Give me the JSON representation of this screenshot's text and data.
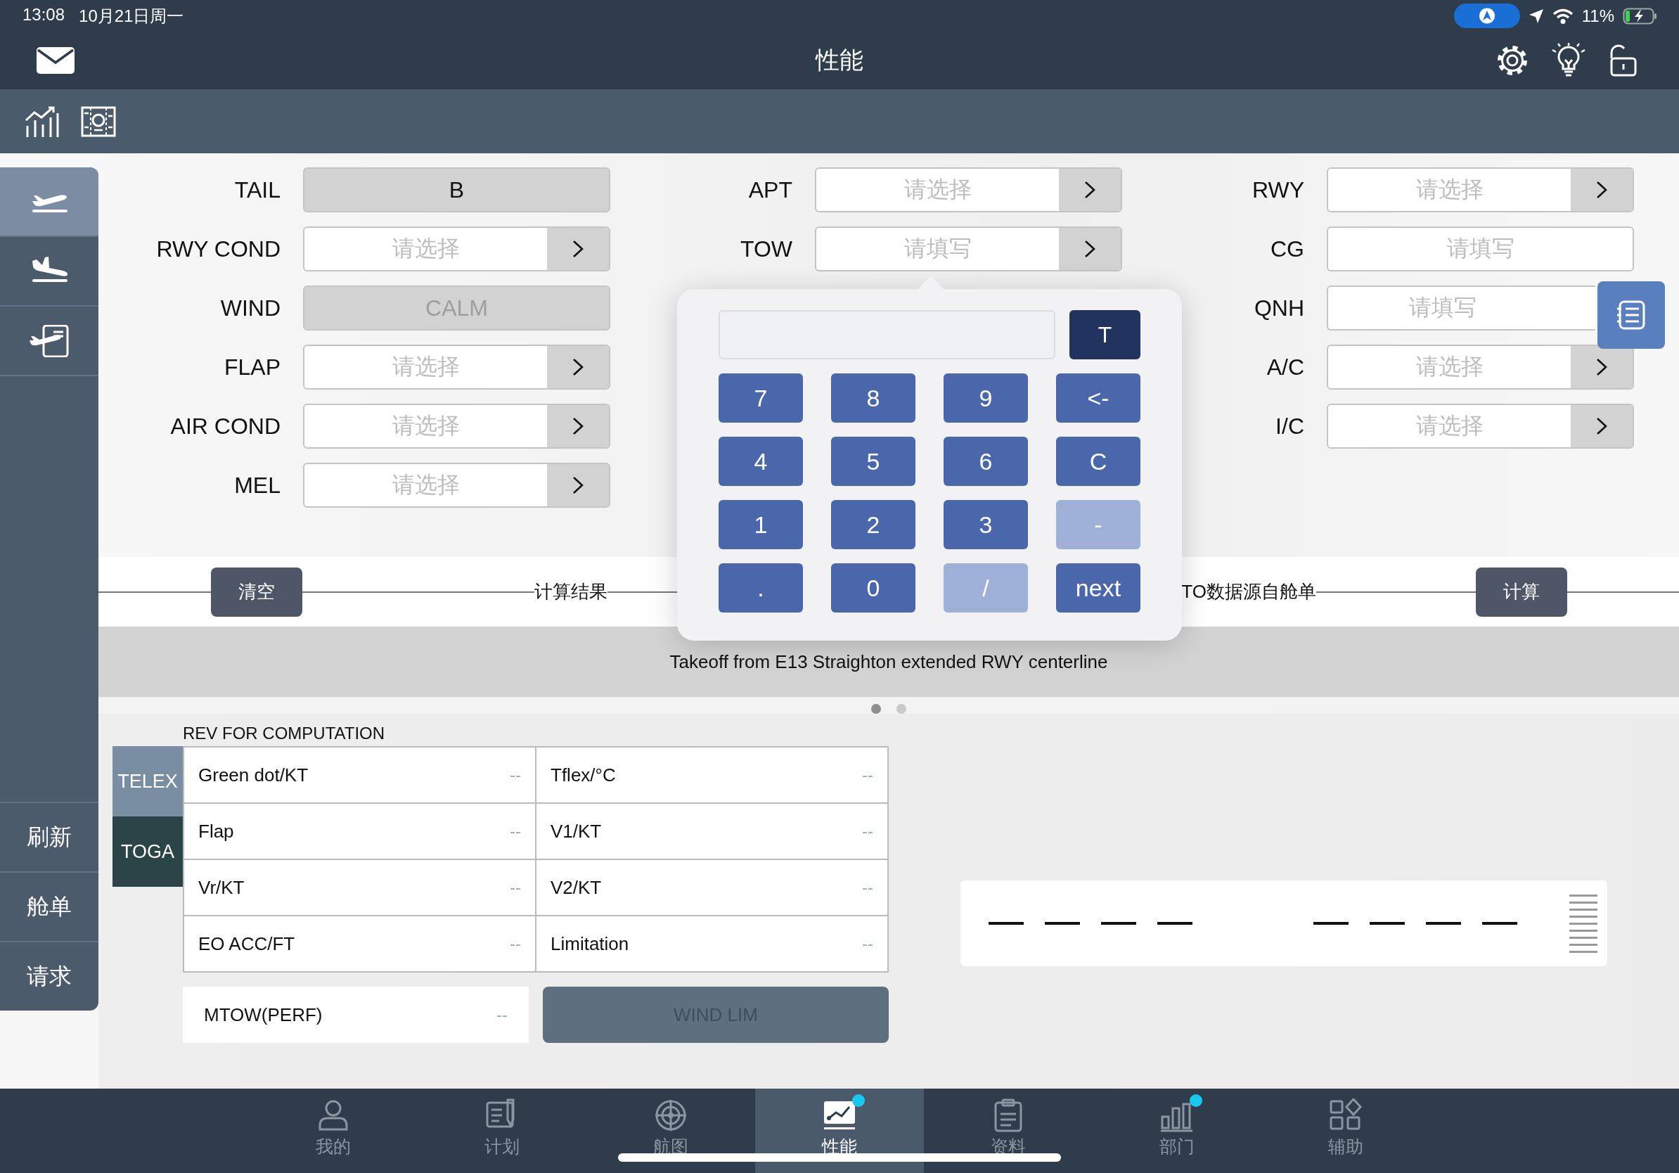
{
  "status_bar": {
    "time": "13:08",
    "date": "10月21日周一",
    "battery": "11%"
  },
  "header": {
    "title": "性能"
  },
  "side_nav": {
    "items": [
      {
        "selected": true
      },
      {
        "selected": false
      },
      {
        "selected": false
      }
    ],
    "actions": [
      "刷新",
      "舱单",
      "请求"
    ]
  },
  "form": {
    "columns": [
      [
        {
          "label": "TAIL",
          "kind": "display",
          "value": "B",
          "disabled": false
        },
        {
          "label": "RWY COND",
          "kind": "select",
          "placeholder": "请选择",
          "disabled": false
        },
        {
          "label": "WIND",
          "kind": "display",
          "value": "CALM",
          "disabled": true
        },
        {
          "label": "FLAP",
          "kind": "select",
          "placeholder": "请选择",
          "disabled": false
        },
        {
          "label": "AIR COND",
          "kind": "select",
          "placeholder": "请选择",
          "disabled": false
        },
        {
          "label": "MEL",
          "kind": "select",
          "placeholder": "请选择",
          "disabled": false
        }
      ],
      [
        {
          "label": "APT",
          "kind": "select",
          "placeholder": "请选择",
          "disabled": false
        },
        {
          "label": "TOW",
          "kind": "select",
          "placeholder": "请填写",
          "disabled": false
        }
      ],
      [
        {
          "label": "RWY",
          "kind": "select",
          "placeholder": "请选择",
          "disabled": false
        },
        {
          "label": "CG",
          "kind": "input",
          "placeholder": "请填写",
          "disabled": false
        },
        {
          "label": "QNH",
          "kind": "input",
          "placeholder": "请填写",
          "disabled": false
        },
        {
          "label": "A/C",
          "kind": "select",
          "placeholder": "请选择",
          "disabled": false
        },
        {
          "label": "I/C",
          "kind": "select",
          "placeholder": "请选择",
          "disabled": false
        }
      ]
    ]
  },
  "result_bar": {
    "clear_button": "清空",
    "title": "计算结果",
    "source_note": "TO数据源自舱单",
    "compute_button": "计算"
  },
  "notice": "Takeoff from E13 Straighton extended RWY centerline",
  "pager": [
    {
      "selected": true
    },
    {
      "selected": false
    }
  ],
  "rev": {
    "title": "REV FOR COMPUTATION",
    "modes": [
      {
        "label": "TELEX",
        "selected": true
      },
      {
        "label": "TOGA",
        "selected": false
      }
    ],
    "rows": [
      [
        {
          "label": "Green dot/KT",
          "value": "--"
        },
        {
          "label": "Tflex/°C",
          "value": "--"
        }
      ],
      [
        {
          "label": "Flap",
          "value": "--"
        },
        {
          "label": "V1/KT",
          "value": "--"
        }
      ],
      [
        {
          "label": "Vr/KT",
          "value": "--"
        },
        {
          "label": "V2/KT",
          "value": "--"
        }
      ],
      [
        {
          "label": "EO ACC/FT",
          "value": "--"
        },
        {
          "label": "Limitation",
          "value": "--"
        }
      ]
    ],
    "mtow": {
      "label": "MTOW(PERF)",
      "value": "--"
    },
    "wind_lim": {
      "label": "WIND LIM",
      "disabled": true
    }
  },
  "keypad": {
    "mode_button": "T",
    "keys": [
      {
        "label": "7",
        "disabled": false
      },
      {
        "label": "8",
        "disabled": false
      },
      {
        "label": "9",
        "disabled": false
      },
      {
        "label": "<-",
        "disabled": false
      },
      {
        "label": "4",
        "disabled": false
      },
      {
        "label": "5",
        "disabled": false
      },
      {
        "label": "6",
        "disabled": false
      },
      {
        "label": "C",
        "disabled": false
      },
      {
        "label": "1",
        "disabled": false
      },
      {
        "label": "2",
        "disabled": false
      },
      {
        "label": "3",
        "disabled": false
      },
      {
        "label": "-",
        "disabled": true
      },
      {
        "label": ".",
        "disabled": false
      },
      {
        "label": "0",
        "disabled": false
      },
      {
        "label": "/",
        "disabled": true
      },
      {
        "label": "next",
        "disabled": false
      }
    ]
  },
  "tab_bar": {
    "items": [
      {
        "label": "我的",
        "selected": false,
        "badge": false
      },
      {
        "label": "计划",
        "selected": false,
        "badge": false
      },
      {
        "label": "航图",
        "selected": false,
        "badge": false
      },
      {
        "label": "性能",
        "selected": true,
        "badge": true
      },
      {
        "label": "资料",
        "selected": false,
        "badge": false
      },
      {
        "label": "部门",
        "selected": false,
        "badge": true
      },
      {
        "label": "辅助",
        "selected": false,
        "badge": false
      }
    ]
  }
}
